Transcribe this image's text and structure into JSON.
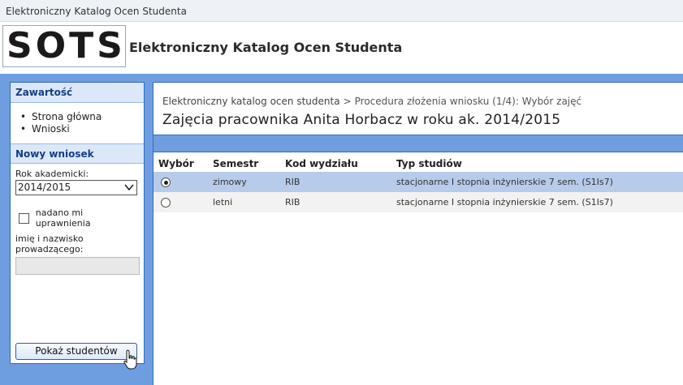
{
  "window": {
    "title": "Elektroniczny Katalog Ocen Studenta"
  },
  "header": {
    "logo_text": "SOTS",
    "app_title": "Elektroniczny Katalog Ocen Studenta"
  },
  "sidebar": {
    "contents_heading": "Zawartość",
    "items": [
      {
        "label": "Strona główna"
      },
      {
        "label": "Wnioski"
      }
    ],
    "new_request_heading": "Nowy wniosek",
    "year_label": "Rok akademicki:",
    "year_value": "2014/2015",
    "permission_label": "nadano mi uprawnienia",
    "permission_checked": false,
    "instructor_label": "imię i nazwisko prowadzącego:",
    "instructor_value": "",
    "show_button": "Pokaż studentów"
  },
  "breadcrumb": {
    "root": "Elektroniczny katalog ocen studenta",
    "separator": ">",
    "current": "Procedura złożenia wniosku (1/4): Wybór zajęć"
  },
  "page_title": "Zajęcia pracownika Anita Horbacz w roku ak. 2014/2015",
  "table": {
    "headers": [
      "Wybór",
      "Semestr",
      "Kod wydziału",
      "Typ studiów"
    ],
    "rows": [
      {
        "selected": true,
        "semester": "zimowy",
        "faculty_code": "RIB",
        "study_type": "stacjonarne I stopnia inżynierskie 7 sem. (S1Is7)"
      },
      {
        "selected": false,
        "semester": "letni",
        "faculty_code": "RIB",
        "study_type": "stacjonarne I stopnia inżynierskie 7 sem. (S1Is7)"
      }
    ]
  },
  "colors": {
    "accent_blue": "#6f9ee0",
    "selected_row": "#b7cbeb",
    "heading_blue": "#133f84"
  }
}
